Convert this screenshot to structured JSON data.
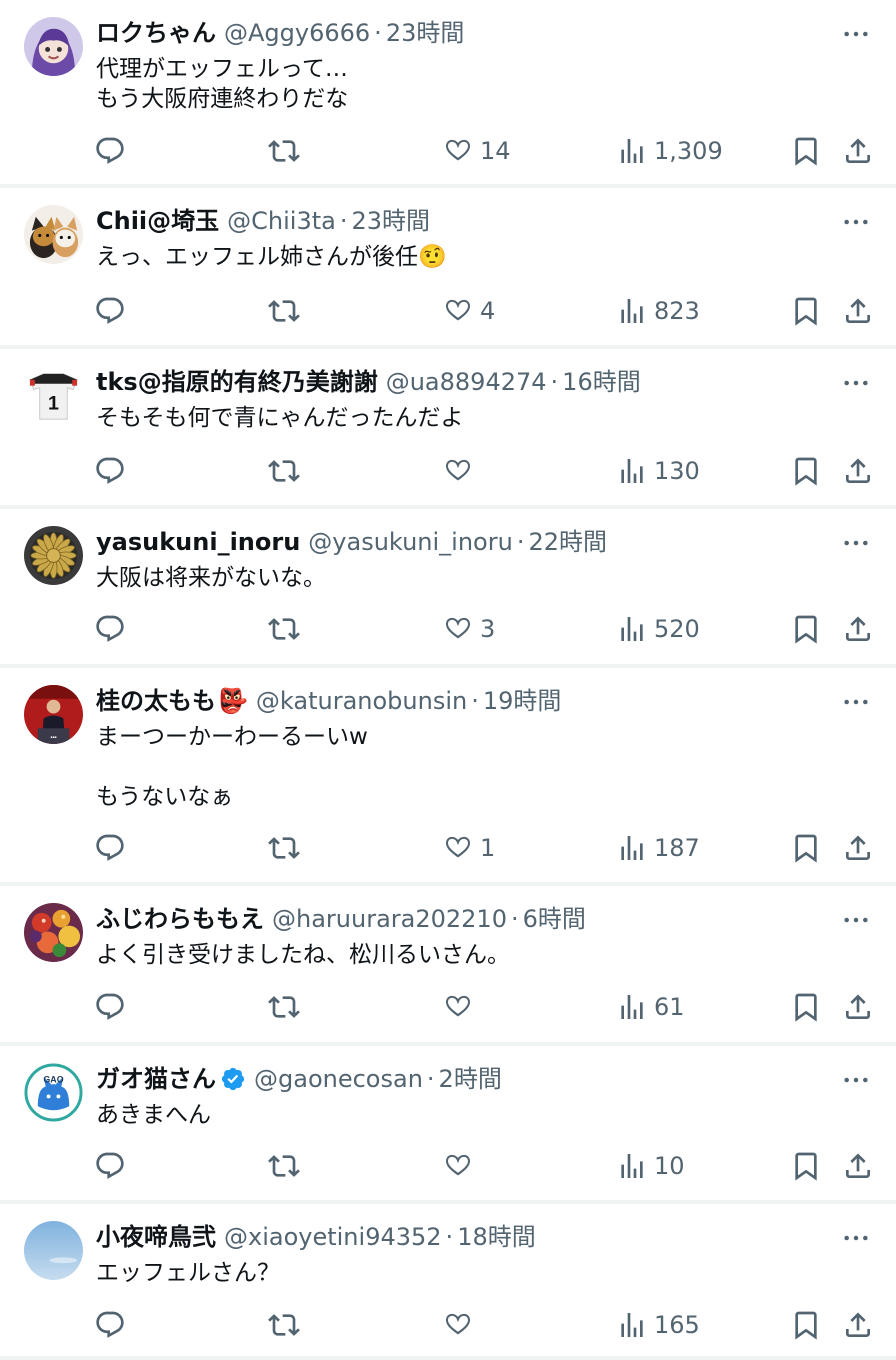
{
  "tweets": [
    {
      "name": "ロクちゃん",
      "name_emoji": "",
      "verified": false,
      "handle": "@Aggy6666",
      "time": "23時間",
      "lines": [
        "代理がエッフェルって…",
        "もう大阪府連終わりだな"
      ],
      "likes": "14",
      "views": "1,309",
      "avatar": "purple-character"
    },
    {
      "name": "Chii@埼玉",
      "name_emoji": "",
      "verified": false,
      "handle": "@Chii3ta",
      "time": "23時間",
      "lines": [
        "えっ、エッフェル姉さんが後任🤨"
      ],
      "likes": "4",
      "views": "823",
      "avatar": "cats"
    },
    {
      "name": "tks@指原的有終乃美謝謝",
      "name_emoji": "",
      "verified": false,
      "handle": "@ua8894274",
      "time": "16時間",
      "lines": [
        "そもそも何で青にゃんだったんだよ"
      ],
      "likes": "",
      "views": "130",
      "avatar": "jersey-number-1"
    },
    {
      "name": "yasukuni_inoru",
      "name_emoji": "",
      "verified": false,
      "handle": "@yasukuni_inoru",
      "time": "22時間",
      "lines": [
        "大阪は将来がないな。"
      ],
      "likes": "3",
      "views": "520",
      "avatar": "chrysanthemum-crest"
    },
    {
      "name": "桂の太もも",
      "name_emoji": "👺",
      "verified": false,
      "handle": "@katuranobunsin",
      "time": "19時間",
      "lines": [
        "まーつーかーわーるーいw",
        "",
        "もうないなぁ"
      ],
      "likes": "1",
      "views": "187",
      "avatar": "speaker-photo"
    },
    {
      "name": "ふじわらももえ",
      "name_emoji": "",
      "verified": false,
      "handle": "@haruurara202210",
      "time": "6時間",
      "lines": [
        "よく引き受けましたね、松川るいさん。"
      ],
      "likes": "",
      "views": "61",
      "avatar": "fruits"
    },
    {
      "name": "ガオ猫さん",
      "name_emoji": "",
      "verified": true,
      "handle": "@gaonecosan",
      "time": "2時間",
      "lines": [
        "あきまへん"
      ],
      "likes": "",
      "views": "10",
      "avatar": "gao-cat",
      "avatar_text": "GAO"
    },
    {
      "name": "小夜啼鳥弐",
      "name_emoji": "",
      "verified": false,
      "handle": "@xiaoyetini94352",
      "time": "18時間",
      "lines": [
        "エッフェルさん？"
      ],
      "likes": "",
      "views": "165",
      "avatar": "sky"
    }
  ],
  "separator": "·",
  "colors": {
    "text": "#0f1419",
    "secondary": "#536471",
    "verified": "#1d9bf0",
    "divider": "#eff3f4"
  }
}
